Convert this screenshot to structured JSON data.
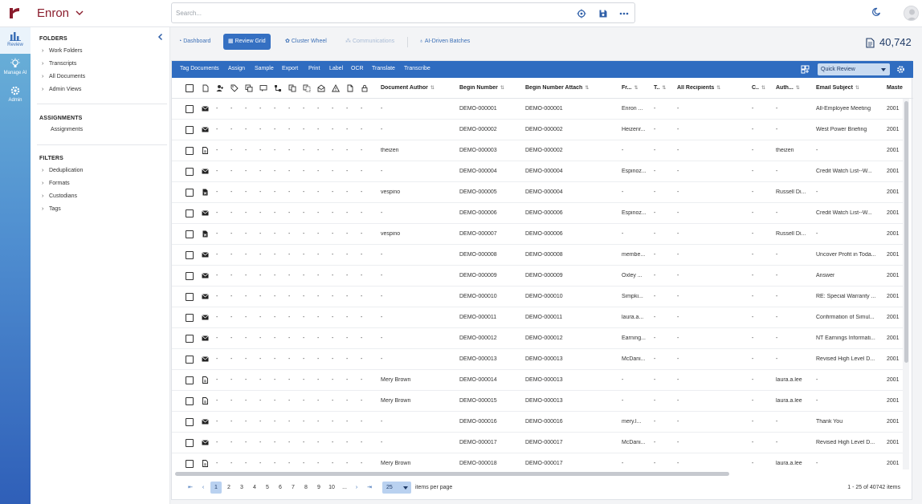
{
  "header": {
    "app_title": "Enron",
    "search_placeholder": "Search..."
  },
  "rail": {
    "items": [
      {
        "label": "Review"
      },
      {
        "label": "Manage AI"
      },
      {
        "label": "Admin"
      }
    ]
  },
  "sidebar": {
    "folders_title": "FOLDERS",
    "folders": [
      "Work Folders",
      "Transcripts",
      "All Documents",
      "Admin Views"
    ],
    "assignments_title": "ASSIGNMENTS",
    "assignments": [
      "Assignments"
    ],
    "filters_title": "FILTERS",
    "filters": [
      "Deduplication",
      "Formats",
      "Custodians",
      "Tags"
    ]
  },
  "tabs": [
    {
      "label": "Dashboard",
      "state": "normal"
    },
    {
      "label": "Review Grid",
      "state": "active"
    },
    {
      "label": "Cluster Wheel",
      "state": "normal"
    },
    {
      "label": "Communications",
      "state": "disabled"
    },
    {
      "label": "AI-Driven Batches",
      "state": "normal"
    }
  ],
  "document_count": "40,742",
  "toolbar": {
    "actions": [
      "Tag Documents",
      "Assign",
      "Sample",
      "Export",
      "Print",
      "Label",
      "OCR",
      "Translate",
      "Transcribe"
    ],
    "view_select": "Quick Review"
  },
  "grid": {
    "columns": [
      "Document Author",
      "Begin Number",
      "Begin Number Attach",
      "Fr...",
      "T..",
      "All Recipients",
      "C..",
      "Auth...",
      "Email Subject",
      "Maste"
    ],
    "rows": [
      {
        "type": "email",
        "author": "-",
        "begin": "DEMO-000001",
        "attach": "DEMO-000001",
        "from": "Enron ...",
        "to": "-",
        "recipients": "-",
        "cc": "-",
        "auth": "-",
        "subject": "All-Employee Meeting",
        "master": "2001"
      },
      {
        "type": "email",
        "author": "-",
        "begin": "DEMO-000002",
        "attach": "DEMO-000002",
        "from": "Heizenr...",
        "to": "-",
        "recipients": "-",
        "cc": "-",
        "auth": "-",
        "subject": "West Power Briefing",
        "master": "2001"
      },
      {
        "type": "file",
        "author": "theizen",
        "begin": "DEMO-000003",
        "attach": "DEMO-000002",
        "from": "-",
        "to": "-",
        "recipients": "-",
        "cc": "-",
        "auth": "theizen",
        "subject": "-",
        "master": "2001"
      },
      {
        "type": "email",
        "author": "-",
        "begin": "DEMO-000004",
        "attach": "DEMO-000004",
        "from": "Espinoz...",
        "to": "-",
        "recipients": "-",
        "cc": "-",
        "auth": "-",
        "subject": "Credit Watch List--W...",
        "master": "2001"
      },
      {
        "type": "docx",
        "author": "vespino",
        "begin": "DEMO-000005",
        "attach": "DEMO-000004",
        "from": "-",
        "to": "-",
        "recipients": "-",
        "cc": "-",
        "auth": "Russell Di...",
        "subject": "-",
        "master": "2001"
      },
      {
        "type": "email",
        "author": "-",
        "begin": "DEMO-000006",
        "attach": "DEMO-000006",
        "from": "Espinoz...",
        "to": "-",
        "recipients": "-",
        "cc": "-",
        "auth": "-",
        "subject": "Credit Watch List--W...",
        "master": "2001"
      },
      {
        "type": "docx",
        "author": "vespino",
        "begin": "DEMO-000007",
        "attach": "DEMO-000006",
        "from": "-",
        "to": "-",
        "recipients": "-",
        "cc": "-",
        "auth": "Russell Di...",
        "subject": "-",
        "master": "2001"
      },
      {
        "type": "email",
        "author": "-",
        "begin": "DEMO-000008",
        "attach": "DEMO-000008",
        "from": "membe...",
        "to": "-",
        "recipients": "-",
        "cc": "-",
        "auth": "-",
        "subject": "Uncover Profit in Toda...",
        "master": "2001"
      },
      {
        "type": "email",
        "author": "-",
        "begin": "DEMO-000009",
        "attach": "DEMO-000009",
        "from": "Oxley ...",
        "to": "-",
        "recipients": "-",
        "cc": "-",
        "auth": "-",
        "subject": "Answer",
        "master": "2001"
      },
      {
        "type": "email",
        "author": "-",
        "begin": "DEMO-000010",
        "attach": "DEMO-000010",
        "from": "Simpki...",
        "to": "-",
        "recipients": "-",
        "cc": "-",
        "auth": "-",
        "subject": "RE: Special Warranty ...",
        "master": "2001"
      },
      {
        "type": "email",
        "author": "-",
        "begin": "DEMO-000011",
        "attach": "DEMO-000011",
        "from": "laura.a...",
        "to": "-",
        "recipients": "-",
        "cc": "-",
        "auth": "-",
        "subject": "Confirmation of Simul...",
        "master": "2001"
      },
      {
        "type": "email",
        "author": "-",
        "begin": "DEMO-000012",
        "attach": "DEMO-000012",
        "from": "Earning...",
        "to": "-",
        "recipients": "-",
        "cc": "-",
        "auth": "-",
        "subject": "NT Earnings Informati...",
        "master": "2001"
      },
      {
        "type": "email",
        "author": "-",
        "begin": "DEMO-000013",
        "attach": "DEMO-000013",
        "from": "McDani...",
        "to": "-",
        "recipients": "-",
        "cc": "-",
        "auth": "-",
        "subject": "Revised High Level D...",
        "master": "2001"
      },
      {
        "type": "file",
        "author": "Mery Brown",
        "begin": "DEMO-000014",
        "attach": "DEMO-000013",
        "from": "-",
        "to": "-",
        "recipients": "-",
        "cc": "-",
        "auth": "laura.a.lee",
        "subject": "-",
        "master": "2001"
      },
      {
        "type": "file",
        "author": "Mery Brown",
        "begin": "DEMO-000015",
        "attach": "DEMO-000013",
        "from": "-",
        "to": "-",
        "recipients": "-",
        "cc": "-",
        "auth": "laura.a.lee",
        "subject": "-",
        "master": "2001"
      },
      {
        "type": "email",
        "author": "-",
        "begin": "DEMO-000016",
        "attach": "DEMO-000016",
        "from": "mery.l...",
        "to": "-",
        "recipients": "-",
        "cc": "-",
        "auth": "-",
        "subject": "Thank You",
        "master": "2001"
      },
      {
        "type": "email",
        "author": "-",
        "begin": "DEMO-000017",
        "attach": "DEMO-000017",
        "from": "McDani...",
        "to": "-",
        "recipients": "-",
        "cc": "-",
        "auth": "-",
        "subject": "Revised High Level D...",
        "master": "2001"
      },
      {
        "type": "file",
        "author": "Mery Brown",
        "begin": "DEMO-000018",
        "attach": "DEMO-000017",
        "from": "-",
        "to": "-",
        "recipients": "-",
        "cc": "-",
        "auth": "laura.a.lee",
        "subject": "-",
        "master": "2001"
      }
    ]
  },
  "pager": {
    "pages": [
      "1",
      "2",
      "3",
      "4",
      "5",
      "6",
      "7",
      "8",
      "9",
      "10",
      "..."
    ],
    "current_page": "1",
    "per_page": "25",
    "per_page_label": "items per page",
    "range_text": "1 - 25 of 40742 items"
  },
  "colors": {
    "brand": "#8a1c2c",
    "accent": "#2f6cc0",
    "tab_active": "#3570c2",
    "select_bg": "#c9dbf1"
  }
}
